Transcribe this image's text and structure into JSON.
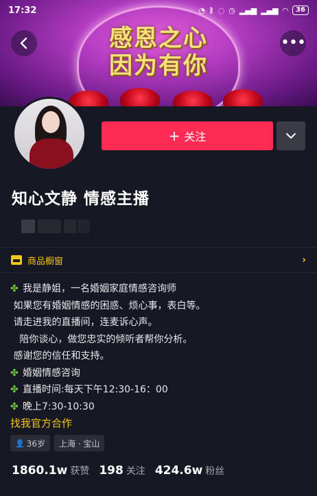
{
  "status_bar": {
    "time": "17:32",
    "battery": "36"
  },
  "banner": {
    "line1": "感恩之心",
    "line2": "因为有你"
  },
  "profile": {
    "follow_label": "关注",
    "name": "知心文静 情感主播"
  },
  "shop": {
    "label": "商品橱窗"
  },
  "bio": {
    "lines": [
      {
        "icon": true,
        "text": "我是静姐，一名婚姻家庭情感咨询师"
      },
      {
        "icon": false,
        "text": " 如果您有婚姻情感的困惑、烦心事，表白等。"
      },
      {
        "icon": false,
        "text": " 请走进我的直播间，连麦诉心声。"
      },
      {
        "icon": false,
        "text": "   陪你谈心，做您忠实的倾听者帮你分析。"
      },
      {
        "icon": false,
        "text": " 感谢您的信任和支持。"
      },
      {
        "icon": true,
        "text": "婚姻情感咨询"
      },
      {
        "icon": true,
        "text": "直播时间:每天下午12:30-16：00"
      },
      {
        "icon": true,
        "text": "晚上7:30-10:30"
      }
    ],
    "link": "找我官方合作"
  },
  "tags": {
    "age": "36岁",
    "location": "上海 · 宝山"
  },
  "stats": [
    {
      "num": "1860.1w",
      "label": "获赞"
    },
    {
      "num": "198",
      "label": "关注"
    },
    {
      "num": "424.6w",
      "label": "粉丝"
    }
  ],
  "colors": {
    "accent": "#fe2c55",
    "shop": "#f5c518",
    "background": "#161823"
  }
}
